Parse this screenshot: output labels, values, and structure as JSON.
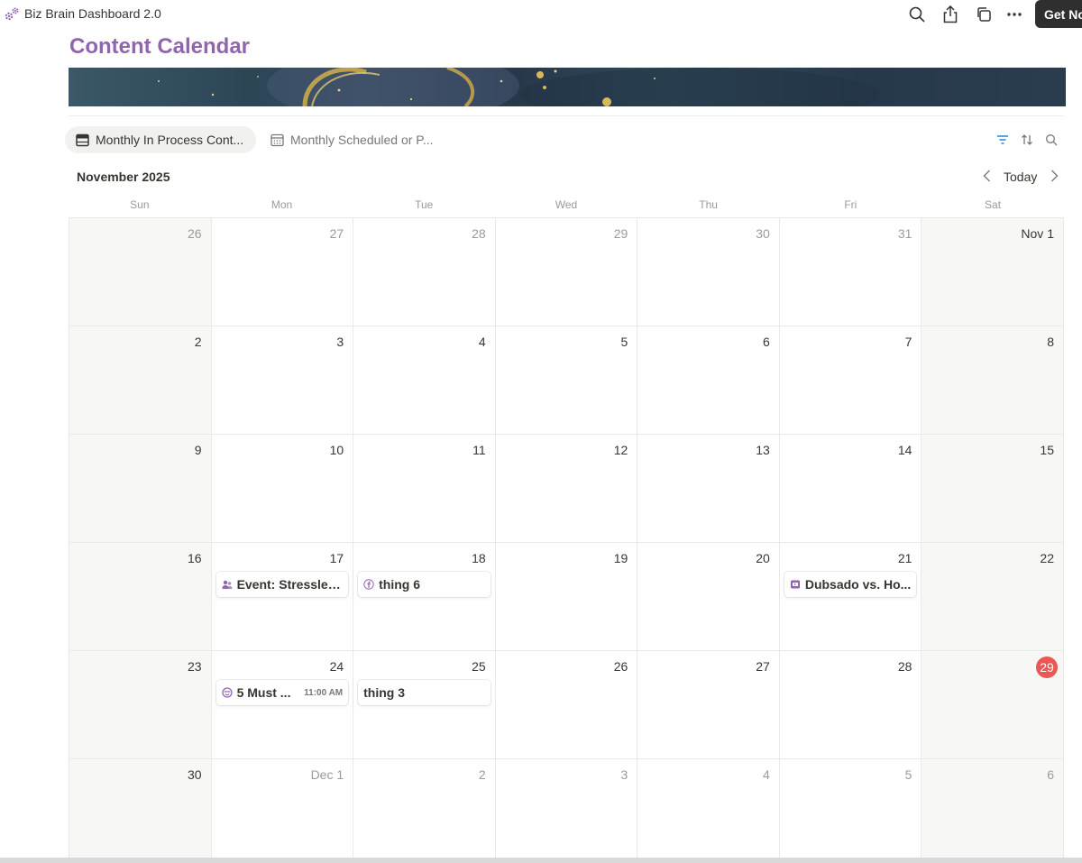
{
  "app": {
    "title": "Biz Brain Dashboard 2.0",
    "get_button": "Get No"
  },
  "page": {
    "title": "Content Calendar",
    "accent": "#9065b0"
  },
  "views": [
    {
      "label": "Monthly In Process Cont...",
      "icon": "calendar-view-icon",
      "active": true
    },
    {
      "label": "Monthly Scheduled or P...",
      "icon": "calendar-grid-icon",
      "active": false
    }
  ],
  "calendar": {
    "month": "November 2025",
    "today_label": "Today",
    "weekdays": [
      "Sun",
      "Mon",
      "Tue",
      "Wed",
      "Thu",
      "Fri",
      "Sat"
    ],
    "weeks": [
      [
        {
          "d": "26",
          "muted": true
        },
        {
          "d": "27",
          "muted": true
        },
        {
          "d": "28",
          "muted": true
        },
        {
          "d": "29",
          "muted": true
        },
        {
          "d": "30",
          "muted": true
        },
        {
          "d": "31",
          "muted": true
        },
        {
          "d": "Nov 1"
        }
      ],
      [
        {
          "d": "2"
        },
        {
          "d": "3"
        },
        {
          "d": "4"
        },
        {
          "d": "5"
        },
        {
          "d": "6"
        },
        {
          "d": "7"
        },
        {
          "d": "8"
        }
      ],
      [
        {
          "d": "9"
        },
        {
          "d": "10"
        },
        {
          "d": "11"
        },
        {
          "d": "12"
        },
        {
          "d": "13"
        },
        {
          "d": "14"
        },
        {
          "d": "15"
        }
      ],
      [
        {
          "d": "16"
        },
        {
          "d": "17",
          "event": {
            "title": "Event: Stressles...",
            "icon": "people-icon"
          }
        },
        {
          "d": "18",
          "event": {
            "title": "thing 6",
            "icon": "facebook-icon"
          }
        },
        {
          "d": "19"
        },
        {
          "d": "20"
        },
        {
          "d": "21",
          "event": {
            "title": "Dubsado vs. Ho...",
            "icon": "video-icon"
          }
        },
        {
          "d": "22"
        }
      ],
      [
        {
          "d": "23"
        },
        {
          "d": "24",
          "event": {
            "title": "5 Must ...",
            "time": "11:00 AM",
            "icon": "smile-icon"
          }
        },
        {
          "d": "25",
          "event": {
            "title": "thing 3"
          }
        },
        {
          "d": "26"
        },
        {
          "d": "27"
        },
        {
          "d": "28"
        },
        {
          "d": "29",
          "today": true
        }
      ],
      [
        {
          "d": "30"
        },
        {
          "d": "Dec 1",
          "muted": true
        },
        {
          "d": "2",
          "muted": true
        },
        {
          "d": "3",
          "muted": true
        },
        {
          "d": "4",
          "muted": true
        },
        {
          "d": "5",
          "muted": true
        },
        {
          "d": "6",
          "muted": true
        }
      ]
    ]
  },
  "colors": {
    "today": "#eb5757",
    "icon_purple": "#9065b0",
    "filter_blue": "#2383e2"
  }
}
